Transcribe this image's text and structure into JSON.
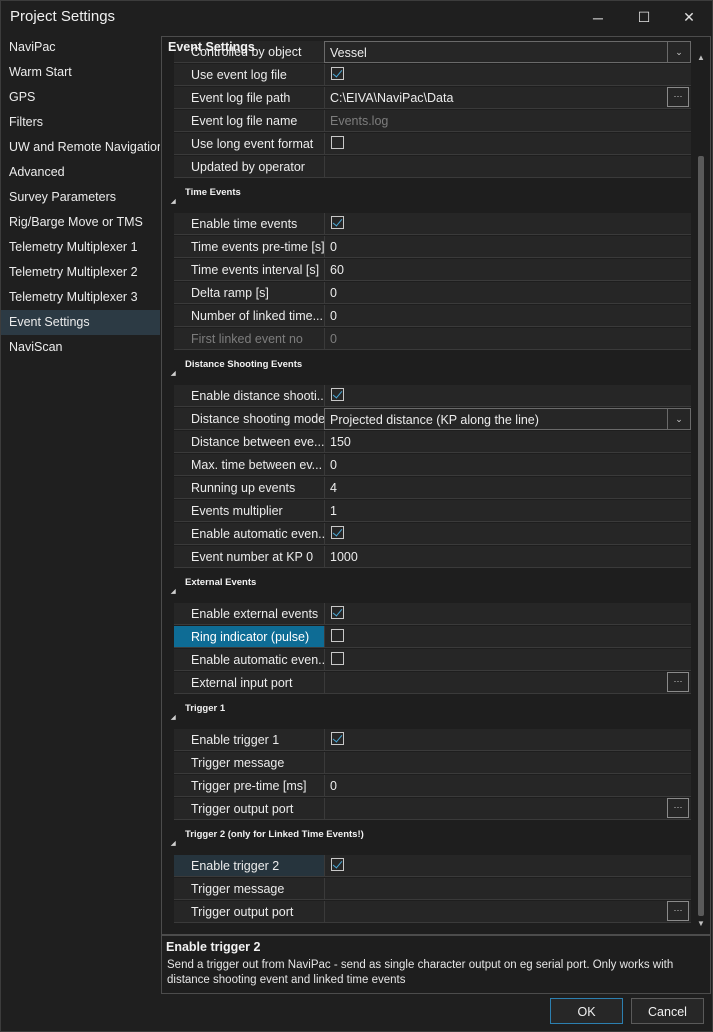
{
  "window": {
    "title": "Project Settings",
    "minimize_glyph": "─",
    "maximize_glyph": "☐",
    "close_glyph": "✕"
  },
  "sidebar": {
    "items": [
      {
        "label": "NaviPac"
      },
      {
        "label": "Warm Start"
      },
      {
        "label": "GPS"
      },
      {
        "label": "Filters"
      },
      {
        "label": "UW and Remote Navigation"
      },
      {
        "label": "Advanced"
      },
      {
        "label": "Survey Parameters"
      },
      {
        "label": "Rig/Barge Move or TMS"
      },
      {
        "label": "Telemetry Multiplexer 1"
      },
      {
        "label": "Telemetry Multiplexer 2"
      },
      {
        "label": "Telemetry Multiplexer 3"
      },
      {
        "label": "Event Settings",
        "selected": true
      },
      {
        "label": "NaviScan"
      }
    ]
  },
  "panel": {
    "title": "Event Settings",
    "sections": [
      {
        "header": "",
        "rows": [
          {
            "label": "Controlled by object",
            "value": "Vessel",
            "type": "combo"
          },
          {
            "label": "Use event log file",
            "type": "checkbox",
            "checked": true
          },
          {
            "label": "Event log file path",
            "value": "C:\\EIVA\\NaviPac\\Data",
            "type": "browse"
          },
          {
            "label": "Event log file name",
            "value": "Events.log",
            "dim": true
          },
          {
            "label": "Use long event format",
            "type": "checkbox",
            "checked": false
          },
          {
            "label": "Updated by operator",
            "value": ""
          }
        ]
      },
      {
        "header": "Time Events",
        "rows": [
          {
            "label": "Enable time events",
            "type": "checkbox",
            "checked": true
          },
          {
            "label": "Time events pre-time [s]",
            "value": "0"
          },
          {
            "label": "Time events interval [s]",
            "value": "60"
          },
          {
            "label": "Delta ramp [s]",
            "value": "0"
          },
          {
            "label": "Number of linked time...",
            "value": "0"
          },
          {
            "label": "First linked event no",
            "value": "0",
            "disabled": true
          }
        ]
      },
      {
        "header": "Distance Shooting Events",
        "rows": [
          {
            "label": "Enable distance shooti...",
            "type": "checkbox",
            "checked": true
          },
          {
            "label": "Distance shooting mode",
            "value": "Projected distance (KP along the line)",
            "type": "combo"
          },
          {
            "label": "Distance between eve...",
            "value": "150"
          },
          {
            "label": "Max. time between ev...",
            "value": "0"
          },
          {
            "label": "Running up events",
            "value": "4"
          },
          {
            "label": "Events multiplier",
            "value": "1"
          },
          {
            "label": "Enable automatic even...",
            "type": "checkbox",
            "checked": true
          },
          {
            "label": "Event number at KP 0",
            "value": "1000"
          }
        ]
      },
      {
        "header": "External Events",
        "rows": [
          {
            "label": "Enable external events",
            "type": "checkbox",
            "checked": true
          },
          {
            "label": "Ring indicator (pulse)",
            "type": "checkbox",
            "checked": false,
            "selected": true
          },
          {
            "label": "Enable automatic even...",
            "type": "checkbox",
            "checked": false
          },
          {
            "label": "External input port",
            "value": "",
            "type": "browse"
          }
        ]
      },
      {
        "header": "Trigger 1",
        "rows": [
          {
            "label": "Enable trigger 1",
            "type": "checkbox",
            "checked": true
          },
          {
            "label": "Trigger message",
            "value": ""
          },
          {
            "label": "Trigger pre-time [ms]",
            "value": "0"
          },
          {
            "label": "Trigger output port",
            "value": "",
            "type": "browse"
          }
        ]
      },
      {
        "header": "Trigger 2 (only for Linked Time Events!)",
        "rows": [
          {
            "label": "Enable trigger 2",
            "type": "checkbox",
            "checked": true,
            "focused": true
          },
          {
            "label": "Trigger message",
            "value": ""
          },
          {
            "label": "Trigger output port",
            "value": "",
            "type": "browse"
          }
        ]
      }
    ]
  },
  "description": {
    "title": "Enable trigger 2",
    "text": "Send a trigger out from NaviPac - send as single character output on eg serial port. Only works with distance shooting event and linked time events"
  },
  "footer": {
    "ok_label": "OK",
    "cancel_label": "Cancel"
  },
  "glyphs": {
    "browse": "···",
    "dropdown": "⌄",
    "collapse": "◢",
    "scroll_up": "▲",
    "scroll_down": "▼"
  },
  "colors": {
    "accent": "#0e6c95",
    "check": "#49a9d8",
    "background": "#1f1f1f"
  }
}
